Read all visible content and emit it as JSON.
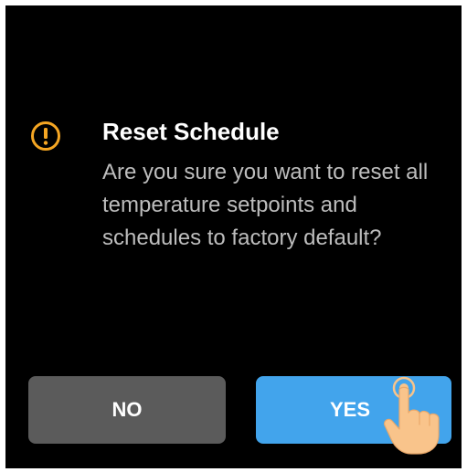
{
  "dialog": {
    "icon": "warning-icon",
    "title": "Reset Schedule",
    "message": "Are you sure you want to reset all temperature setpoints and schedules to factory default?"
  },
  "buttons": {
    "no_label": "NO",
    "yes_label": "YES"
  },
  "gesture": {
    "icon": "tap-hand-icon"
  },
  "colors": {
    "background": "#000000",
    "warning": "#f5a623",
    "no_button": "#5b5b5b",
    "yes_button": "#42a4ec",
    "title_text": "#ffffff",
    "message_text": "#bdbdbd",
    "hand_skin": "#f9c48b"
  }
}
